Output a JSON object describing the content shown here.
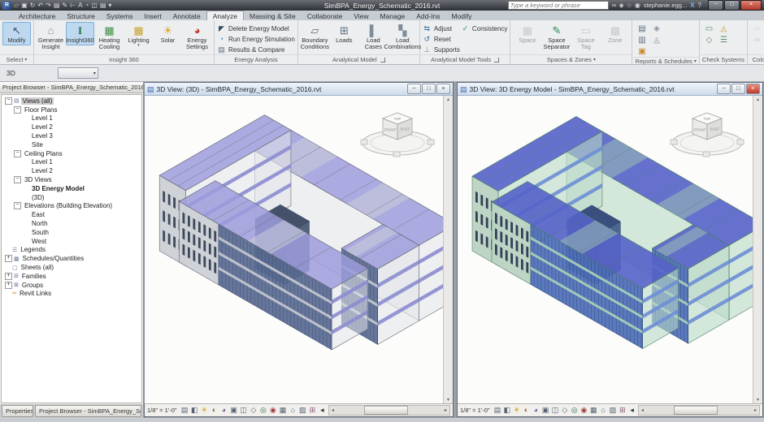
{
  "window": {
    "title": "SimBPA_Energy_Schematic_2016.rvt",
    "search_placeholder": "Type a keyword or phrase",
    "user": "stephanie.egg...",
    "exchange_label": "X",
    "help_label": "?",
    "min_label": "−",
    "max_label": "□",
    "close_label": "×"
  },
  "qat": [
    {
      "name": "open-icon",
      "glyph": "▱"
    },
    {
      "name": "save-icon",
      "glyph": "▣"
    },
    {
      "name": "sync-icon",
      "glyph": "↻"
    },
    {
      "name": "undo-icon",
      "glyph": "↶"
    },
    {
      "name": "redo-icon",
      "glyph": "↷"
    },
    {
      "name": "print-icon",
      "glyph": "▤"
    },
    {
      "name": "measure-icon",
      "glyph": "✎"
    },
    {
      "name": "aligned-dimension-icon",
      "glyph": "⊢"
    },
    {
      "name": "text-icon",
      "glyph": "A"
    },
    {
      "name": "default-3d-view-icon",
      "glyph": "◔"
    },
    {
      "name": "section-icon",
      "glyph": "◫"
    },
    {
      "name": "sheet-icon",
      "glyph": "▤"
    },
    {
      "name": "qat-toggle-icon",
      "glyph": "▾"
    }
  ],
  "search_icons": [
    {
      "name": "search-binoculars-icon",
      "glyph": "∞"
    },
    {
      "name": "subscription-icon",
      "glyph": "◈"
    },
    {
      "name": "favorites-star-icon",
      "glyph": "☆"
    },
    {
      "name": "signin-user-icon",
      "glyph": "◉"
    }
  ],
  "ribbon": {
    "tabs": [
      "Architecture",
      "Structure",
      "Systems",
      "Insert",
      "Annotate",
      "Analyze",
      "Massing & Site",
      "Collaborate",
      "View",
      "Manage",
      "Add-Ins",
      "Modify"
    ],
    "active_tab": "Analyze",
    "panels": [
      {
        "name": "Select",
        "arrow": true,
        "type": "bigs",
        "items": [
          {
            "name": "modify-button",
            "label": "Modify",
            "glyph": "↖",
            "color": "#44506a",
            "active": true
          }
        ]
      },
      {
        "name": "Insight 360",
        "type": "bigs",
        "items": [
          {
            "name": "generate-insight-button",
            "label": "Generate Insight",
            "glyph": "⌂",
            "color": "#8a8f98"
          },
          {
            "name": "insight360-button",
            "label": "Insight360",
            "glyph": "I",
            "color": "#1e7145",
            "active": true
          },
          {
            "name": "heating-cooling-button",
            "label": "Heating Cooling",
            "glyph": "▦",
            "color": "#3e8e41"
          },
          {
            "name": "lighting-button",
            "label": "Lighting",
            "glyph": "▦",
            "color": "#c9a227",
            "dropdown": true
          },
          {
            "name": "solar-button",
            "label": "Solar",
            "glyph": "☀",
            "color": "#e0a11f"
          },
          {
            "name": "energy-settings-button",
            "label": "Energy Settings",
            "glyph": "◕",
            "color": "#c0392b"
          }
        ]
      },
      {
        "name": "Energy Analysis",
        "type": "rows",
        "items": [
          {
            "name": "delete-energy-model-button",
            "label": "Delete Energy Model",
            "glyph": "◤",
            "color": "#34495e"
          },
          {
            "name": "run-energy-simulation-button",
            "label": "Run Energy Simulation",
            "glyph": "◔",
            "color": "#2e86c1"
          },
          {
            "name": "results-compare-button",
            "label": "Results & Compare",
            "glyph": "▤",
            "color": "#5d6d7e"
          }
        ]
      },
      {
        "name": "Analytical Model",
        "launcher": true,
        "type": "bigs",
        "items": [
          {
            "name": "boundary-conditions-button",
            "label": "Boundary Conditions",
            "glyph": "▱",
            "color": "#5d6d7e"
          },
          {
            "name": "loads-button",
            "label": "Loads",
            "glyph": "⊞",
            "color": "#5d6d7e"
          },
          {
            "name": "load-cases-button",
            "label": "Load Cases",
            "glyph": "▌",
            "color": "#7f8c9a"
          },
          {
            "name": "load-combinations-button",
            "label": "Load Combinations",
            "glyph": "▚",
            "color": "#7f8c9a"
          }
        ]
      },
      {
        "name": "Analytical Model Tools",
        "launcher": true,
        "type": "rows2",
        "items": [
          {
            "name": "adjust-button",
            "label": "Adjust",
            "glyph": "⇆",
            "color": "#3a6ea5",
            "col": 1
          },
          {
            "name": "reset-button",
            "label": "Reset",
            "glyph": "↺",
            "color": "#3a6ea5",
            "col": 1
          },
          {
            "name": "supports-button",
            "label": "Supports",
            "glyph": "⊥",
            "color": "#7f8c9a",
            "col": 1
          },
          {
            "name": "consistency-button",
            "label": "Consistency",
            "glyph": "✓",
            "color": "#2e8b57",
            "col": 2
          }
        ]
      },
      {
        "name": "Spaces & Zones",
        "arrow": true,
        "type": "bigs",
        "items": [
          {
            "name": "space-button",
            "label": "Space",
            "glyph": "▦",
            "color": "#9aa4ae",
            "disabled": true
          },
          {
            "name": "space-separator-button",
            "label": "Space Separator",
            "glyph": "✎",
            "color": "#2e8b57"
          },
          {
            "name": "space-tag-button",
            "label": "Space Tag",
            "glyph": "▭",
            "color": "#9aa4ae",
            "disabled": true
          },
          {
            "name": "zone-button",
            "label": "Zone",
            "glyph": "▩",
            "color": "#9aa4ae",
            "disabled": true
          }
        ]
      },
      {
        "name": "Reports & Schedules",
        "arrow": true,
        "type": "grid",
        "items": [
          {
            "name": "panel-schedules-icon",
            "glyph": "▤",
            "color": "#5d6d7e"
          },
          {
            "name": "schedule-quantities-icon",
            "glyph": "◈",
            "color": "#8a94a0"
          },
          {
            "name": "material-takeoff-icon",
            "glyph": "▥",
            "color": "#5d6d7e"
          },
          {
            "name": "graphical-column-schedule-icon",
            "glyph": "◬",
            "color": "#8a94a0"
          },
          {
            "name": "sheet-list-icon",
            "glyph": "▣",
            "color": "#c9882a"
          }
        ]
      },
      {
        "name": "Check Systems",
        "type": "grid",
        "items": [
          {
            "name": "check-duct-systems-icon",
            "glyph": "▭",
            "color": "#5d8a5d"
          },
          {
            "name": "show-disconnects-icon",
            "glyph": "◬",
            "color": "#c9a227"
          },
          {
            "name": "check-pipe-systems-icon",
            "glyph": "◇",
            "color": "#5d8a5d"
          },
          {
            "name": "check-circuits-icon",
            "glyph": "☰",
            "color": "#5d8a5d"
          }
        ]
      },
      {
        "name": "Color Fill",
        "type": "grid",
        "items": [
          {
            "name": "duct-legend-icon",
            "glyph": "▱",
            "color": "#aab2ba",
            "disabled": true
          },
          {
            "name": "pipe-legend-icon",
            "glyph": "▱",
            "color": "#aab2ba",
            "disabled": true
          },
          {
            "name": "color-fill-legend-icon",
            "glyph": "≔",
            "color": "#aab2ba",
            "disabled": true
          }
        ]
      }
    ]
  },
  "options_bar": {
    "view_label": "3D"
  },
  "project_browser": {
    "title": "Project Browser - SimBPA_Energy_Schematic_2016...",
    "close_label": "×",
    "tree": [
      {
        "label": "Views (all)",
        "level": 0,
        "expand": "-",
        "icon": "views-icon",
        "glyph": "▤",
        "selected": true
      },
      {
        "label": "Floor Plans",
        "level": 1,
        "expand": "-"
      },
      {
        "label": "Level 1",
        "level": 2
      },
      {
        "label": "Level 2",
        "level": 2
      },
      {
        "label": "Level 3",
        "level": 2
      },
      {
        "label": "Site",
        "level": 2
      },
      {
        "label": "Ceiling Plans",
        "level": 1,
        "expand": "-"
      },
      {
        "label": "Level 1",
        "level": 2
      },
      {
        "label": "Level 2",
        "level": 2
      },
      {
        "label": "3D Views",
        "level": 1,
        "expand": "-"
      },
      {
        "label": "3D Energy Model",
        "level": 2,
        "bold": true
      },
      {
        "label": "(3D)",
        "level": 2
      },
      {
        "label": "Elevations (Building Elevation)",
        "level": 1,
        "expand": "-"
      },
      {
        "label": "East",
        "level": 2
      },
      {
        "label": "North",
        "level": 2
      },
      {
        "label": "South",
        "level": 2
      },
      {
        "label": "West",
        "level": 2
      },
      {
        "label": "Legends",
        "level": 0,
        "icon": "legends-icon",
        "glyph": "☰"
      },
      {
        "label": "Schedules/Quantities",
        "level": 0,
        "expand": "+",
        "icon": "schedules-icon",
        "glyph": "▦"
      },
      {
        "label": "Sheets (all)",
        "level": 0,
        "icon": "sheets-icon",
        "glyph": "▢"
      },
      {
        "label": "Families",
        "level": 0,
        "expand": "+",
        "icon": "families-icon",
        "glyph": "⊞"
      },
      {
        "label": "Groups",
        "level": 0,
        "expand": "+",
        "icon": "groups-icon",
        "glyph": "⊠"
      },
      {
        "label": "Revit Links",
        "level": 0,
        "icon": "revit-links-icon",
        "glyph": "∞"
      }
    ]
  },
  "views": [
    {
      "title": "3D View: (3D) - SimBPA_Energy_Schematic_2016.rvt",
      "scale": "1/8\" = 1'-0\"",
      "palette": "revit",
      "active": false
    },
    {
      "title": "3D View: 3D Energy Model - SimBPA_Energy_Schematic_2016.rvt",
      "scale": "1/8\" = 1'-0\"",
      "palette": "energy",
      "active": true
    }
  ],
  "viewcube": {
    "top_face": "TOP",
    "left_face": "FRONT",
    "right_face": "EAST"
  },
  "view_controls": [
    {
      "name": "detail-level-icon",
      "glyph": "▤",
      "color": "#556070"
    },
    {
      "name": "visual-style-icon",
      "glyph": "◧",
      "color": "#556070"
    },
    {
      "name": "sun-path-icon",
      "glyph": "☀",
      "color": "#c9a227"
    },
    {
      "name": "shadows-icon",
      "glyph": "◐",
      "color": "#8a5a3a"
    },
    {
      "name": "rendering-dialog-icon",
      "glyph": "◕",
      "color": "#7a6a9a"
    },
    {
      "name": "crop-view-icon",
      "glyph": "▣",
      "color": "#556070"
    },
    {
      "name": "show-crop-region-icon",
      "glyph": "◫",
      "color": "#556070"
    },
    {
      "name": "unlocked-view-icon",
      "glyph": "◇",
      "color": "#556070"
    },
    {
      "name": "temporary-hide-isolate-icon",
      "glyph": "◎",
      "color": "#2e6b4f"
    },
    {
      "name": "reveal-hidden-elements-icon",
      "glyph": "◉",
      "color": "#a03c3c"
    },
    {
      "name": "temporary-view-properties-icon",
      "glyph": "▦",
      "color": "#556070"
    },
    {
      "name": "analytical-model-icon",
      "glyph": "⌂",
      "color": "#4a6a8a"
    },
    {
      "name": "displacement-sets-icon",
      "glyph": "▨",
      "color": "#556070"
    },
    {
      "name": "reveal-constraints-icon",
      "glyph": "⊞",
      "color": "#8a5577"
    },
    {
      "name": "collapse-arrow-icon",
      "glyph": "◂",
      "color": "#333333"
    }
  ],
  "statusbar": {
    "tabs": [
      "Properties",
      "Project Browser - SimBPA_Energy_Sche..."
    ]
  },
  "palettes": {
    "revit": {
      "roof": "#9c9cdc",
      "roofOp": 0.85,
      "edge": "#6a6a78",
      "patch": "#ced2d8",
      "wall": "#e2e4e9",
      "wallOp": 0.55,
      "slab": "#8d8dd0",
      "curtain": "#5a6c92",
      "mullion": "#36466a",
      "band": "#c2c6cd",
      "solid": "#cdd1d6",
      "punch": "#2e3a4e",
      "glass": "#42536f",
      "glassTop": "#3d4a63"
    },
    "energy": {
      "roof": "#5562c8",
      "roofOp": 0.9,
      "edge": "#4d7d6a",
      "patch": "#9fc6b0",
      "wall": "#b9d8c6",
      "wallOp": 0.6,
      "slab": "#6e8fd6",
      "curtain": "#4f6fb8",
      "mullion": "#223c6e",
      "band": "#a8cdb8",
      "solid": "#bcd4c4",
      "punch": "#24304a",
      "glass": "#3d5a85",
      "glassTop": "#34497a"
    }
  }
}
